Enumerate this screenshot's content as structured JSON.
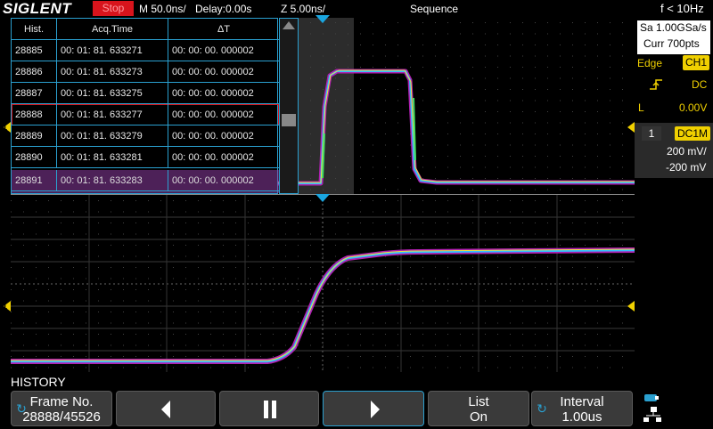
{
  "top_bar": {
    "brand": "SIGLENT",
    "run_state": "Stop",
    "timebase": "M 50.0ns/",
    "delay": "Delay:0.00s",
    "zoom_timebase": "Z 5.00ns/",
    "mode": "Sequence",
    "frequency": "f < 10Hz"
  },
  "acquisition": {
    "sample_rate": "Sa 1.00GSa/s",
    "memory_depth": "Curr 700pts"
  },
  "trigger": {
    "type": "Edge",
    "source": "CH1",
    "slope_icon": "rising-edge-icon",
    "coupling": "DC",
    "level_label": "L",
    "level": "0.00V"
  },
  "channel": {
    "number": "1",
    "coupling_impedance": "DC1M",
    "scale": "200 mV/",
    "offset": "-200 mV",
    "marker_label": "1",
    "color": "#f0d000"
  },
  "history_table": {
    "headers": [
      "Hist.",
      "Acq.Time",
      "ΔT"
    ],
    "rows": [
      {
        "frame": "28885",
        "acq_time": "00: 01: 81. 633271",
        "delta": "00: 00: 00. 000002"
      },
      {
        "frame": "28886",
        "acq_time": "00: 01: 81. 633273",
        "delta": "00: 00: 00. 000002"
      },
      {
        "frame": "28887",
        "acq_time": "00: 01: 81. 633275",
        "delta": "00: 00: 00. 000002"
      },
      {
        "frame": "28888",
        "acq_time": "00: 01: 81. 633277",
        "delta": "00: 00: 00. 000002"
      },
      {
        "frame": "28889",
        "acq_time": "00: 01: 81. 633279",
        "delta": "00: 00: 00. 000002"
      },
      {
        "frame": "28890",
        "acq_time": "00: 01: 81. 633281",
        "delta": "00: 00: 00. 000002"
      },
      {
        "frame": "28891",
        "acq_time": "00: 01: 81. 633283",
        "delta": "00: 00: 00. 000002"
      }
    ],
    "selected_frame": "28888"
  },
  "bottom": {
    "menu_title": "HISTORY",
    "frame_label": "Frame No.",
    "frame_value": "28888/45526",
    "prev_icon": "previous-icon",
    "pause_icon": "pause-icon",
    "play_icon": "play-icon",
    "list_label": "List",
    "list_value": "On",
    "interval_label": "Interval",
    "interval_value": "1.00us",
    "usb_icon": "usb-network-icon"
  },
  "colors": {
    "accent": "#2aa0d0",
    "channel1": "#f0d000",
    "stop": "#d8141c"
  }
}
